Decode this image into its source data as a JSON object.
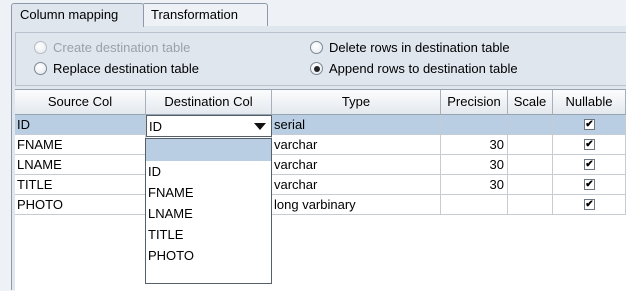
{
  "tabs": [
    {
      "label": "Column mapping"
    },
    {
      "label": "Transformation"
    }
  ],
  "options": {
    "create_table": "Create destination table",
    "replace_table": "Replace destination table",
    "delete_rows": "Delete rows in destination table",
    "append_rows": "Append rows to destination table",
    "selected": "append_rows"
  },
  "grid": {
    "headers": [
      "Source Col",
      "Destination Col",
      "Type",
      "Precision",
      "Scale",
      "Nullable"
    ],
    "rows": [
      {
        "source": "ID",
        "dest": "ID",
        "type": "serial",
        "precision": "",
        "scale": "",
        "nullable": true
      },
      {
        "source": "FNAME",
        "dest": "",
        "type": "varchar",
        "precision": "30",
        "scale": "",
        "nullable": true
      },
      {
        "source": "LNAME",
        "dest": "",
        "type": "varchar",
        "precision": "30",
        "scale": "",
        "nullable": true
      },
      {
        "source": "TITLE",
        "dest": "",
        "type": "varchar",
        "precision": "30",
        "scale": "",
        "nullable": true
      },
      {
        "source": "PHOTO",
        "dest": "",
        "type": "long varbinary",
        "precision": "",
        "scale": "",
        "nullable": true
      }
    ]
  },
  "dropdown": {
    "current": "ID",
    "options": [
      "",
      "ID",
      "FNAME",
      "LNAME",
      "TITLE",
      "PHOTO"
    ]
  },
  "check_mark": "✔"
}
